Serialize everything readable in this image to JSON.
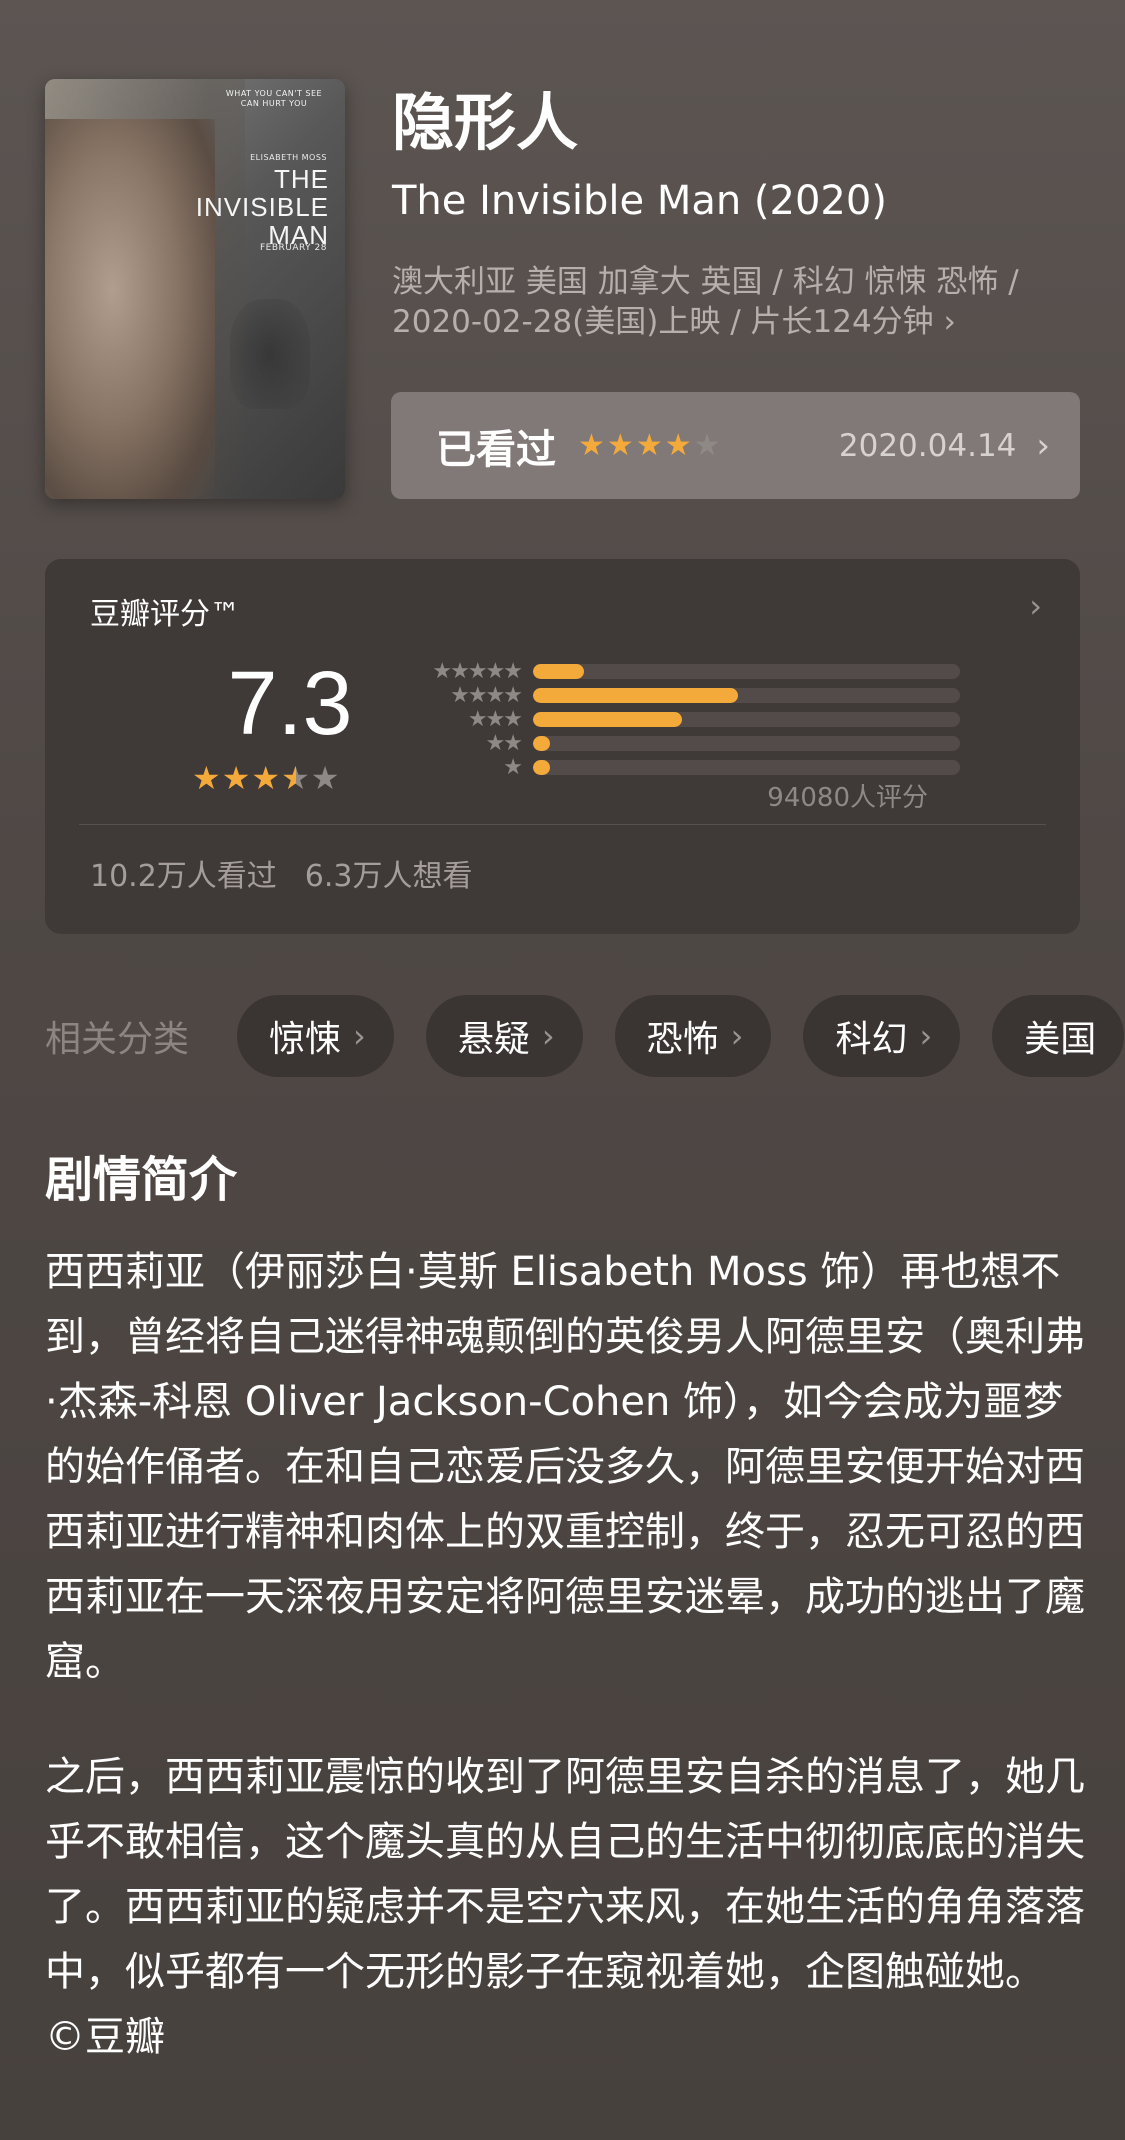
{
  "poster": {
    "tagline": "WHAT YOU CAN'T SEE CAN HURT YOU",
    "actor": "ELISABETH MOSS",
    "title": "THE\nINVISIBLE\nMAN",
    "date": "FEBRUARY 28"
  },
  "movie": {
    "title_cn": "隐形人",
    "title_en": "The Invisible Man (2020)",
    "meta_line1": "澳大利亚 美国 加拿大 英国 / 科幻 惊悚 恐怖 /",
    "meta_line2": "2020-02-28(美国)上映 / 片长124分钟",
    "meta_arrow": "›"
  },
  "watched": {
    "label": "已看过",
    "user_rating": 4,
    "date": "2020.04.14",
    "arrow": "›"
  },
  "rating": {
    "title": "豆瓣评分™",
    "arrow": "›",
    "score": "7.3",
    "stars_value": 3.5,
    "distribution": [
      {
        "stars": 5,
        "fraction": 0.12
      },
      {
        "stars": 4,
        "fraction": 0.48
      },
      {
        "stars": 3,
        "fraction": 0.35
      },
      {
        "stars": 2,
        "fraction": 0.04
      },
      {
        "stars": 1,
        "fraction": 0.04
      }
    ],
    "count": "94080人评分",
    "watched": "10.2万人看过",
    "want": "6.3万人想看"
  },
  "related": {
    "label": "相关分类",
    "tags": [
      "惊悚",
      "悬疑",
      "恐怖",
      "科幻",
      "美国"
    ]
  },
  "synopsis": {
    "title": "剧情简介",
    "p1": "西西莉亚（伊丽莎白·莫斯 Elisabeth Moss 饰）再也想不到，曾经将自己迷得神魂颠倒的英俊男人阿德里安（奥利弗·杰森-科恩 Oliver Jackson-Cohen 饰），如今会成为噩梦的始作俑者。在和自己恋爱后没多久，阿德里安便开始对西西莉亚进行精神和肉体上的双重控制，终于，忍无可忍的西西莉亚在一天深夜用安定将阿德里安迷晕，成功的逃出了魔窟。",
    "p2": "之后，西西莉亚震惊的收到了阿德里安自杀的消息了，她几乎不敢相信，这个魔头真的从自己的生活中彻彻底底的消失了。西西莉亚的疑虑并不是空穴来风，在她生活的角角落落中，似乎都有一个无形的影子在窥视着她，企图触碰她。 ©豆瓣"
  },
  "colors": {
    "accent": "#f4a93b",
    "background": "#4f4845",
    "card": "#3f3937"
  }
}
